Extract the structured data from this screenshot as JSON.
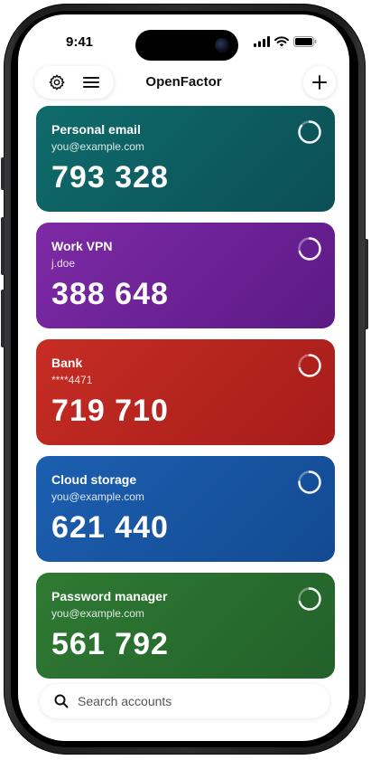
{
  "status_bar": {
    "time": "9:41",
    "icons": [
      "signal-icon",
      "wifi-icon",
      "battery-icon"
    ]
  },
  "header": {
    "title": "OpenFactor",
    "left_icons": [
      "gear-icon",
      "menu-icon"
    ],
    "right_icon": "plus-icon"
  },
  "accounts": [
    {
      "name": "Personal email",
      "user": "you@example.com",
      "code": "793 328",
      "color_start": "#0f6b6b",
      "color_end": "#0b4f55",
      "timer_remaining": 0.85
    },
    {
      "name": "Work VPN",
      "user": "j.doe",
      "code": "388 648",
      "color_start": "#7e2aa6",
      "color_end": "#5c1a86",
      "timer_remaining": 0.7
    },
    {
      "name": "Bank",
      "user": "****4471",
      "code": "719 710",
      "color_start": "#c62d24",
      "color_end": "#a61c1a",
      "timer_remaining": 0.7
    },
    {
      "name": "Cloud storage",
      "user": "you@example.com",
      "code": "621 440",
      "color_start": "#1c5fb0",
      "color_end": "#134a92",
      "timer_remaining": 0.75
    },
    {
      "name": "Password manager",
      "user": "you@example.com",
      "code": "561 792",
      "color_start": "#2f7a33",
      "color_end": "#22612a",
      "timer_remaining": 0.7
    }
  ],
  "search": {
    "placeholder": "Search accounts",
    "value": ""
  }
}
